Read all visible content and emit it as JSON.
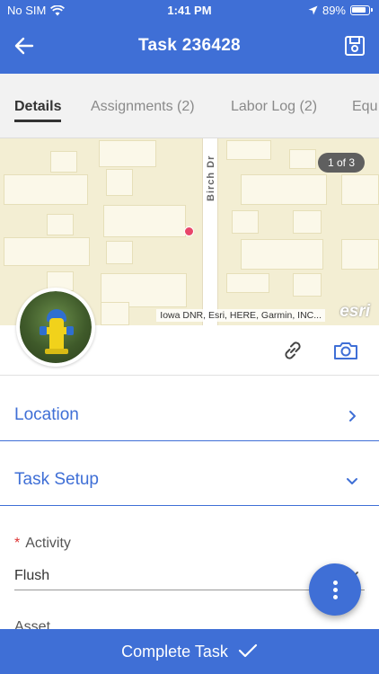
{
  "status_bar": {
    "carrier": "No SIM",
    "time": "1:41 PM",
    "battery": "89%"
  },
  "header": {
    "title": "Task 236428",
    "back_icon": "arrow-left-icon",
    "save_icon": "floppy-disk-icon"
  },
  "tabs": [
    {
      "label": "Details",
      "active": true
    },
    {
      "label": "Assignments (2)",
      "active": false
    },
    {
      "label": "Labor Log (2)",
      "active": false
    },
    {
      "label": "Equ",
      "active": false
    }
  ],
  "map": {
    "street_label": "Birch Dr",
    "pager": "1 of 3",
    "attribution": "Iowa DNR, Esri, HERE, Garmin, INC...",
    "logo": "esri"
  },
  "media": {
    "link_icon": "link-icon",
    "camera_icon": "camera-icon"
  },
  "sections": {
    "location": {
      "label": "Location",
      "expanded": false
    },
    "task_setup": {
      "label": "Task Setup",
      "expanded": true
    }
  },
  "fields": {
    "activity": {
      "required_mark": "*",
      "label": "Activity",
      "value": "Flush"
    },
    "asset": {
      "label": "Asset"
    }
  },
  "bottom_bar": {
    "label": "Complete Task"
  },
  "colors": {
    "primary": "#3f6fd6",
    "required": "#dd3333",
    "map_pin": "#e8466a"
  }
}
